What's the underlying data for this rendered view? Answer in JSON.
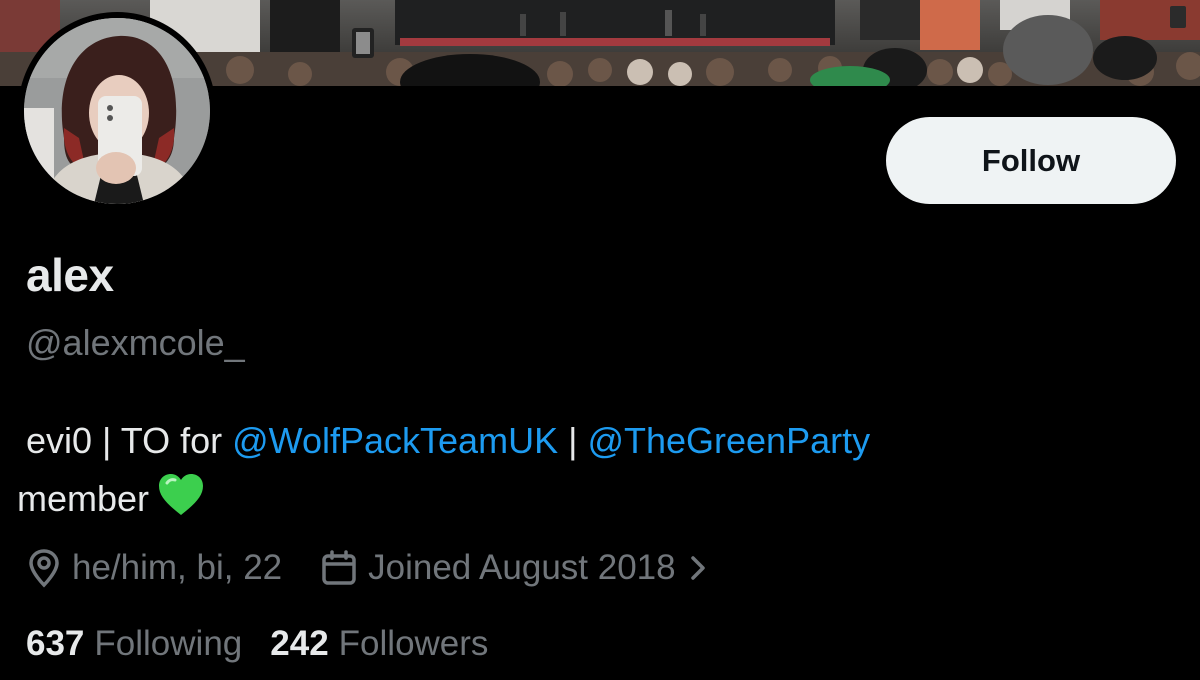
{
  "profile": {
    "display_name": "alex",
    "handle": "@alexmcole_",
    "follow_label": "Follow",
    "bio": {
      "text_1": "evi0 | TO for ",
      "mention_1": "@WolfPackTeamUK",
      "text_2": " | ",
      "mention_2": "@TheGreenParty",
      "text_3": " member",
      "emoji": "green-heart"
    },
    "location": "he/him, bi, 22",
    "joined": "Joined August 2018",
    "following_count": "637",
    "following_label": "Following",
    "followers_count": "242",
    "followers_label": "Followers"
  },
  "icons": {
    "location": "location-pin-icon",
    "calendar": "calendar-icon",
    "chevron": "chevron-right-icon"
  },
  "colors": {
    "background": "#000000",
    "text_primary": "#e7e9ea",
    "text_secondary": "#71767b",
    "link": "#1d9bf0",
    "button_bg": "#eff3f4",
    "button_text": "#0f1419",
    "heart": "#3ccf4e"
  }
}
